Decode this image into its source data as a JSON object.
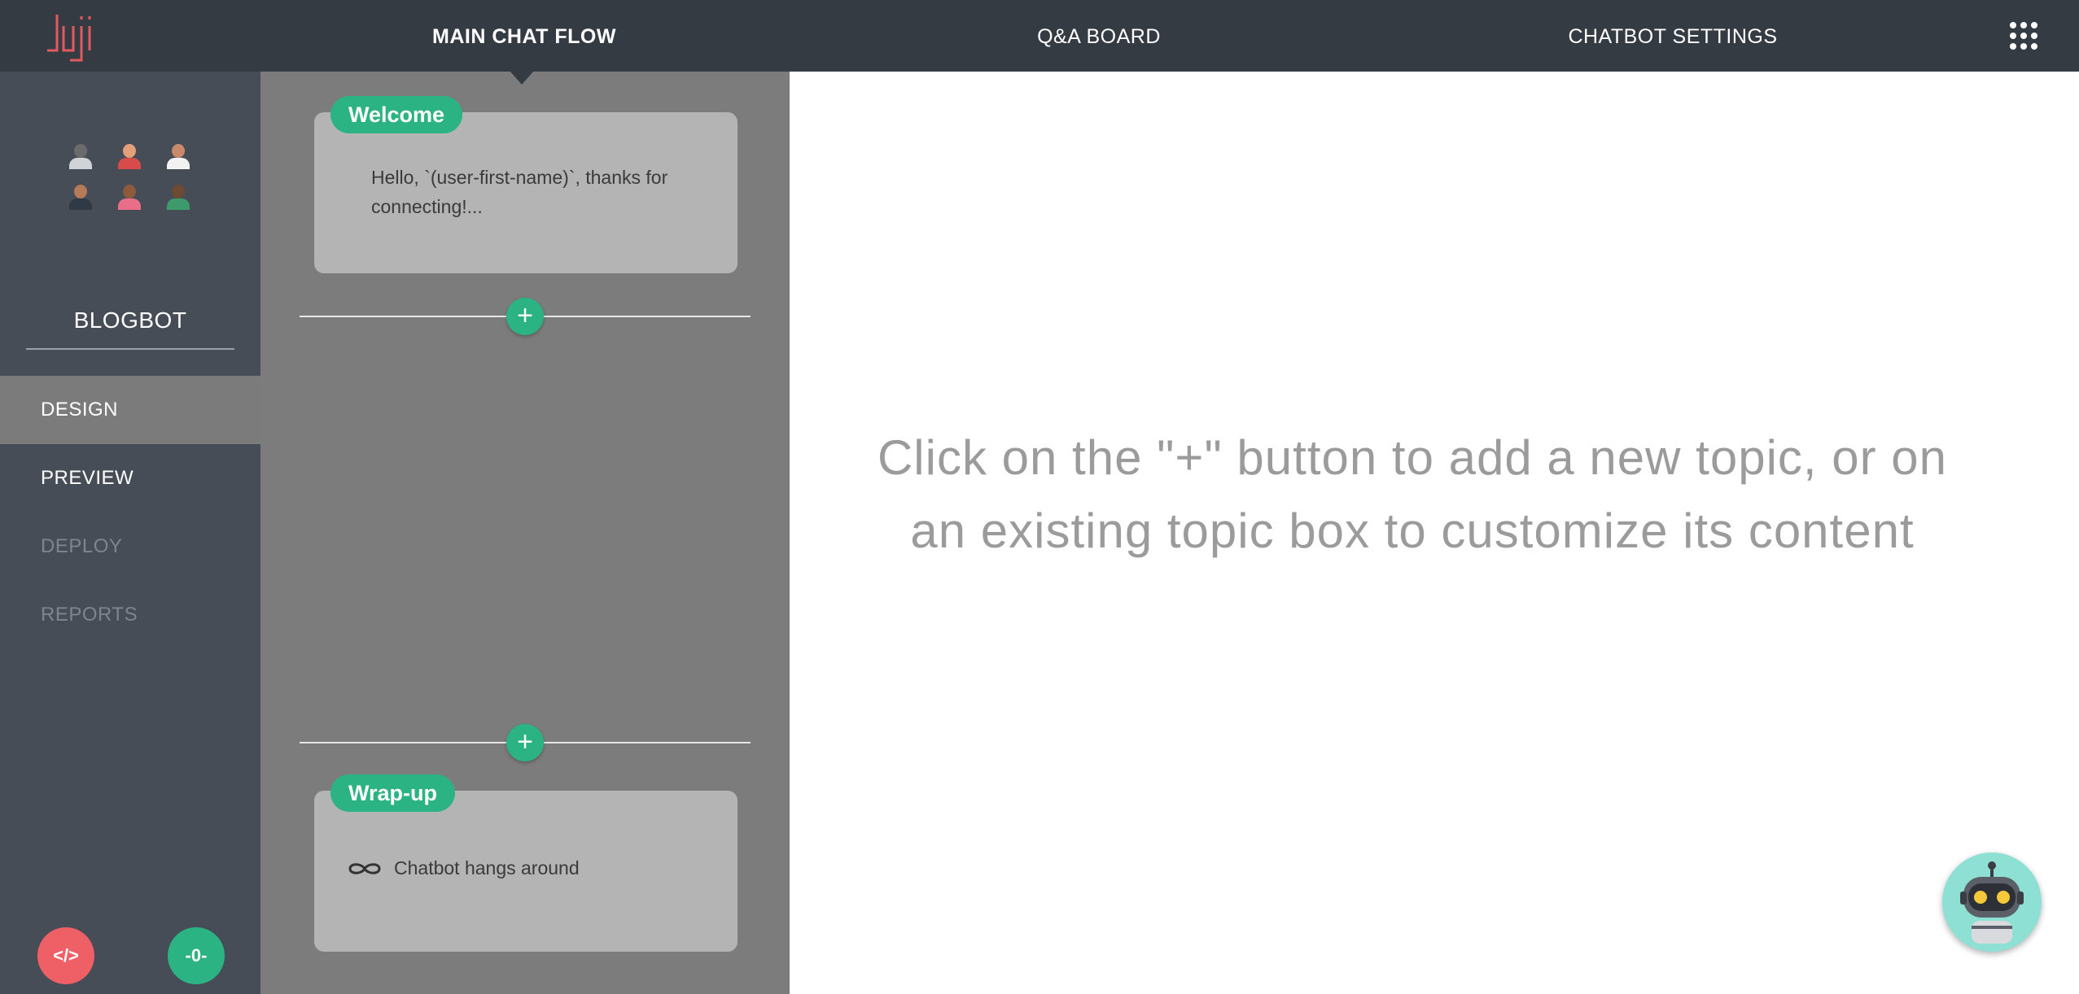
{
  "header": {
    "logo_text": "Juji",
    "nav": [
      {
        "label": "MAIN CHAT FLOW",
        "active": true
      },
      {
        "label": "Q&A BOARD",
        "active": false
      },
      {
        "label": "CHATBOT SETTINGS",
        "active": false
      }
    ],
    "apps_icon": "grid-dots-icon"
  },
  "sidebar": {
    "bot_name": "BLOGBOT",
    "items": [
      {
        "label": "DESIGN",
        "state": "active"
      },
      {
        "label": "PREVIEW",
        "state": "enabled"
      },
      {
        "label": "DEPLOY",
        "state": "disabled"
      },
      {
        "label": "REPORTS",
        "state": "disabled"
      }
    ],
    "code_button_label": "</>",
    "status_button_label": "-0-",
    "avatar_colors": [
      "#8fe0d4",
      "#f5c93a",
      "#7fc6d2",
      "#f4a132",
      "#39b48f",
      "#f7d682"
    ]
  },
  "flow": {
    "welcome": {
      "tag": "Welcome",
      "text": "Hello, `(user-first-name)`, thanks for connecting!..."
    },
    "wrapup": {
      "tag": "Wrap-up",
      "text": "Chatbot hangs around",
      "icon": "infinity-icon"
    },
    "add_label": "+"
  },
  "main": {
    "hint": "Click on the \"+\" button to add a new topic, or on an existing topic box to customize its content"
  },
  "colors": {
    "topbar": "#353b43",
    "sidebar": "#474d56",
    "flow_bg": "#7c7c7c",
    "accent_green": "#2bb383",
    "accent_red": "#ee5f66"
  }
}
